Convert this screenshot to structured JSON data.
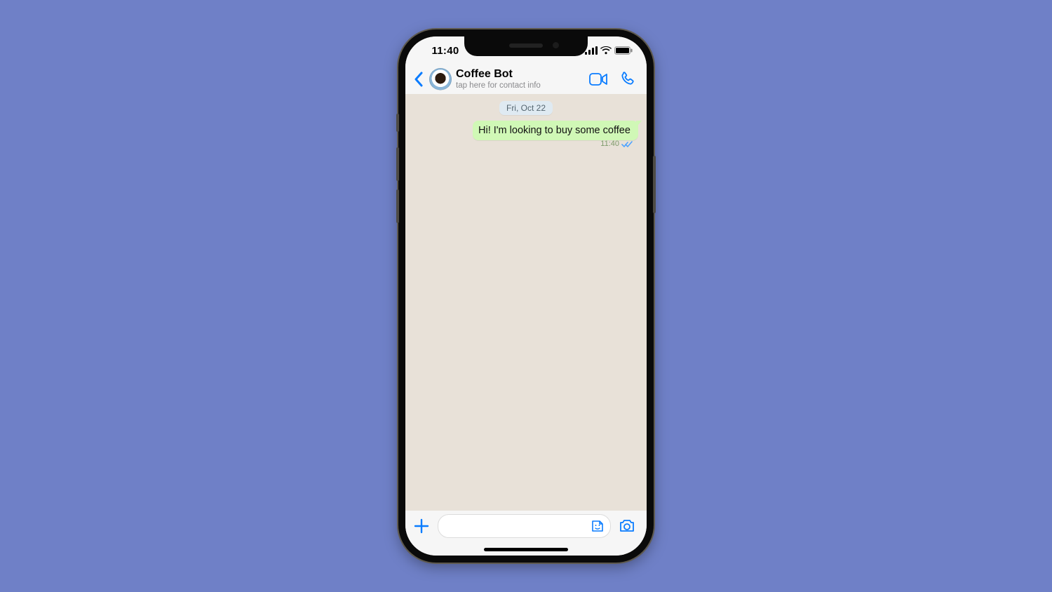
{
  "status": {
    "time": "11:40"
  },
  "chat": {
    "contact_name": "Coffee Bot",
    "subtitle": "tap here for contact info",
    "date_chip": "Fri, Oct 22"
  },
  "messages": [
    {
      "text": "Hi! I'm looking to buy some coffee",
      "time": "11:40",
      "outgoing": true,
      "read": true
    }
  ],
  "composer": {
    "placeholder": ""
  },
  "colors": {
    "accent": "#0a7cff",
    "outgoing_bubble": "#d0f8b6",
    "chat_bg": "#e8e1d8",
    "page_bg": "#6f80c7"
  }
}
